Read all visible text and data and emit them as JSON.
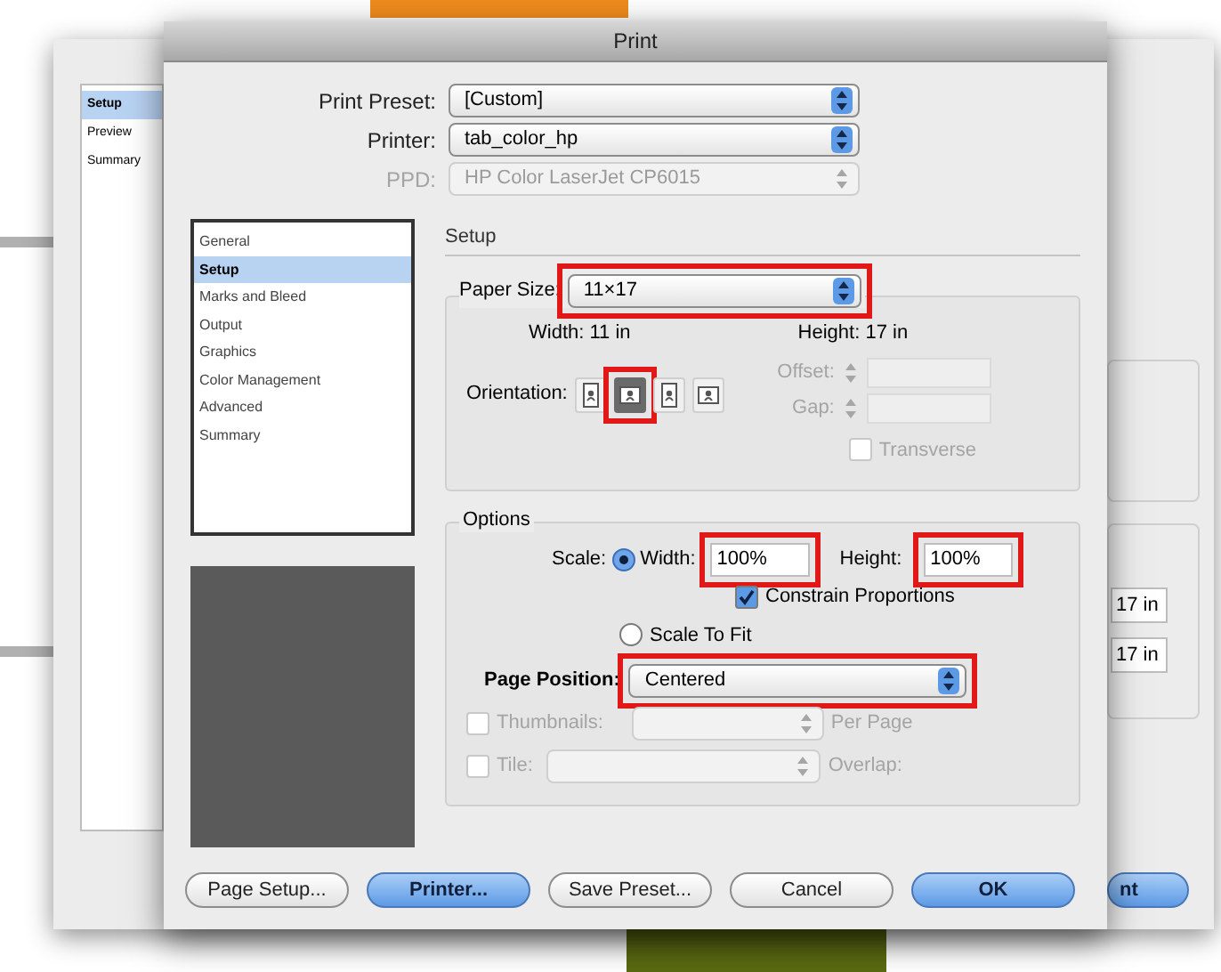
{
  "background_window": {
    "sidebar_items": [
      {
        "label": "Setup",
        "selected": true
      },
      {
        "label": "Preview",
        "selected": false
      },
      {
        "label": "Summary",
        "selected": false
      }
    ],
    "fields": [
      {
        "value": "17 in"
      },
      {
        "value": "17 in"
      }
    ],
    "button_fragment": "nt"
  },
  "dialog": {
    "title": "Print",
    "header_fields": [
      {
        "label": "Print Preset:",
        "value": "[Custom]",
        "disabled": false
      },
      {
        "label": "Printer:",
        "value": "tab_color_hp",
        "disabled": false
      },
      {
        "label": "PPD:",
        "value": "HP Color LaserJet CP6015",
        "disabled": true
      }
    ],
    "categories": [
      {
        "label": "General",
        "selected": false
      },
      {
        "label": "Setup",
        "selected": true
      },
      {
        "label": "Marks and Bleed",
        "selected": false
      },
      {
        "label": "Output",
        "selected": false
      },
      {
        "label": "Graphics",
        "selected": false
      },
      {
        "label": "Color Management",
        "selected": false
      },
      {
        "label": "Advanced",
        "selected": false
      },
      {
        "label": "Summary",
        "selected": false
      }
    ],
    "section_title": "Setup",
    "paper": {
      "label": "Paper Size:",
      "value": "11×17",
      "highlighted": true,
      "width_label": "Width:",
      "width": "11 in",
      "height_label": "Height:",
      "height": "17 in",
      "orientation_label": "Orientation:",
      "orientations": [
        {
          "selected": false,
          "highlighted": false
        },
        {
          "selected": true,
          "highlighted": true
        },
        {
          "selected": false,
          "highlighted": false
        },
        {
          "selected": false,
          "highlighted": false
        }
      ],
      "offset": {
        "label": "Offset:",
        "disabled": true
      },
      "gap": {
        "label": "Gap:",
        "disabled": true
      },
      "transverse": {
        "label": "Transverse",
        "checked": false,
        "disabled": true
      }
    },
    "options": {
      "title": "Options",
      "scale_label": "Scale:",
      "width_radio": {
        "label": "Width:",
        "selected": true
      },
      "width_value": {
        "value": "100%",
        "highlighted": true
      },
      "height_label": "Height:",
      "height_value": {
        "value": "100%",
        "highlighted": true
      },
      "constrain": {
        "label": "Constrain Proportions",
        "checked": true
      },
      "scale_to_fit": {
        "label": "Scale To Fit",
        "selected": false
      },
      "page_position": {
        "label": "Page Position:",
        "value": "Centered",
        "highlighted": true
      },
      "thumbnails": {
        "label": "Thumbnails:",
        "checked": false,
        "disabled": true,
        "suffix": "Per Page"
      },
      "tile": {
        "label": "Tile:",
        "checked": false,
        "disabled": true,
        "suffix": "Overlap:"
      }
    },
    "buttons": [
      {
        "label": "Page Setup...",
        "default": false
      },
      {
        "label": "Printer...",
        "default": true
      },
      {
        "label": "Save Preset...",
        "default": false
      },
      {
        "label": "Cancel",
        "default": false
      },
      {
        "label": "OK",
        "default": true
      }
    ]
  }
}
